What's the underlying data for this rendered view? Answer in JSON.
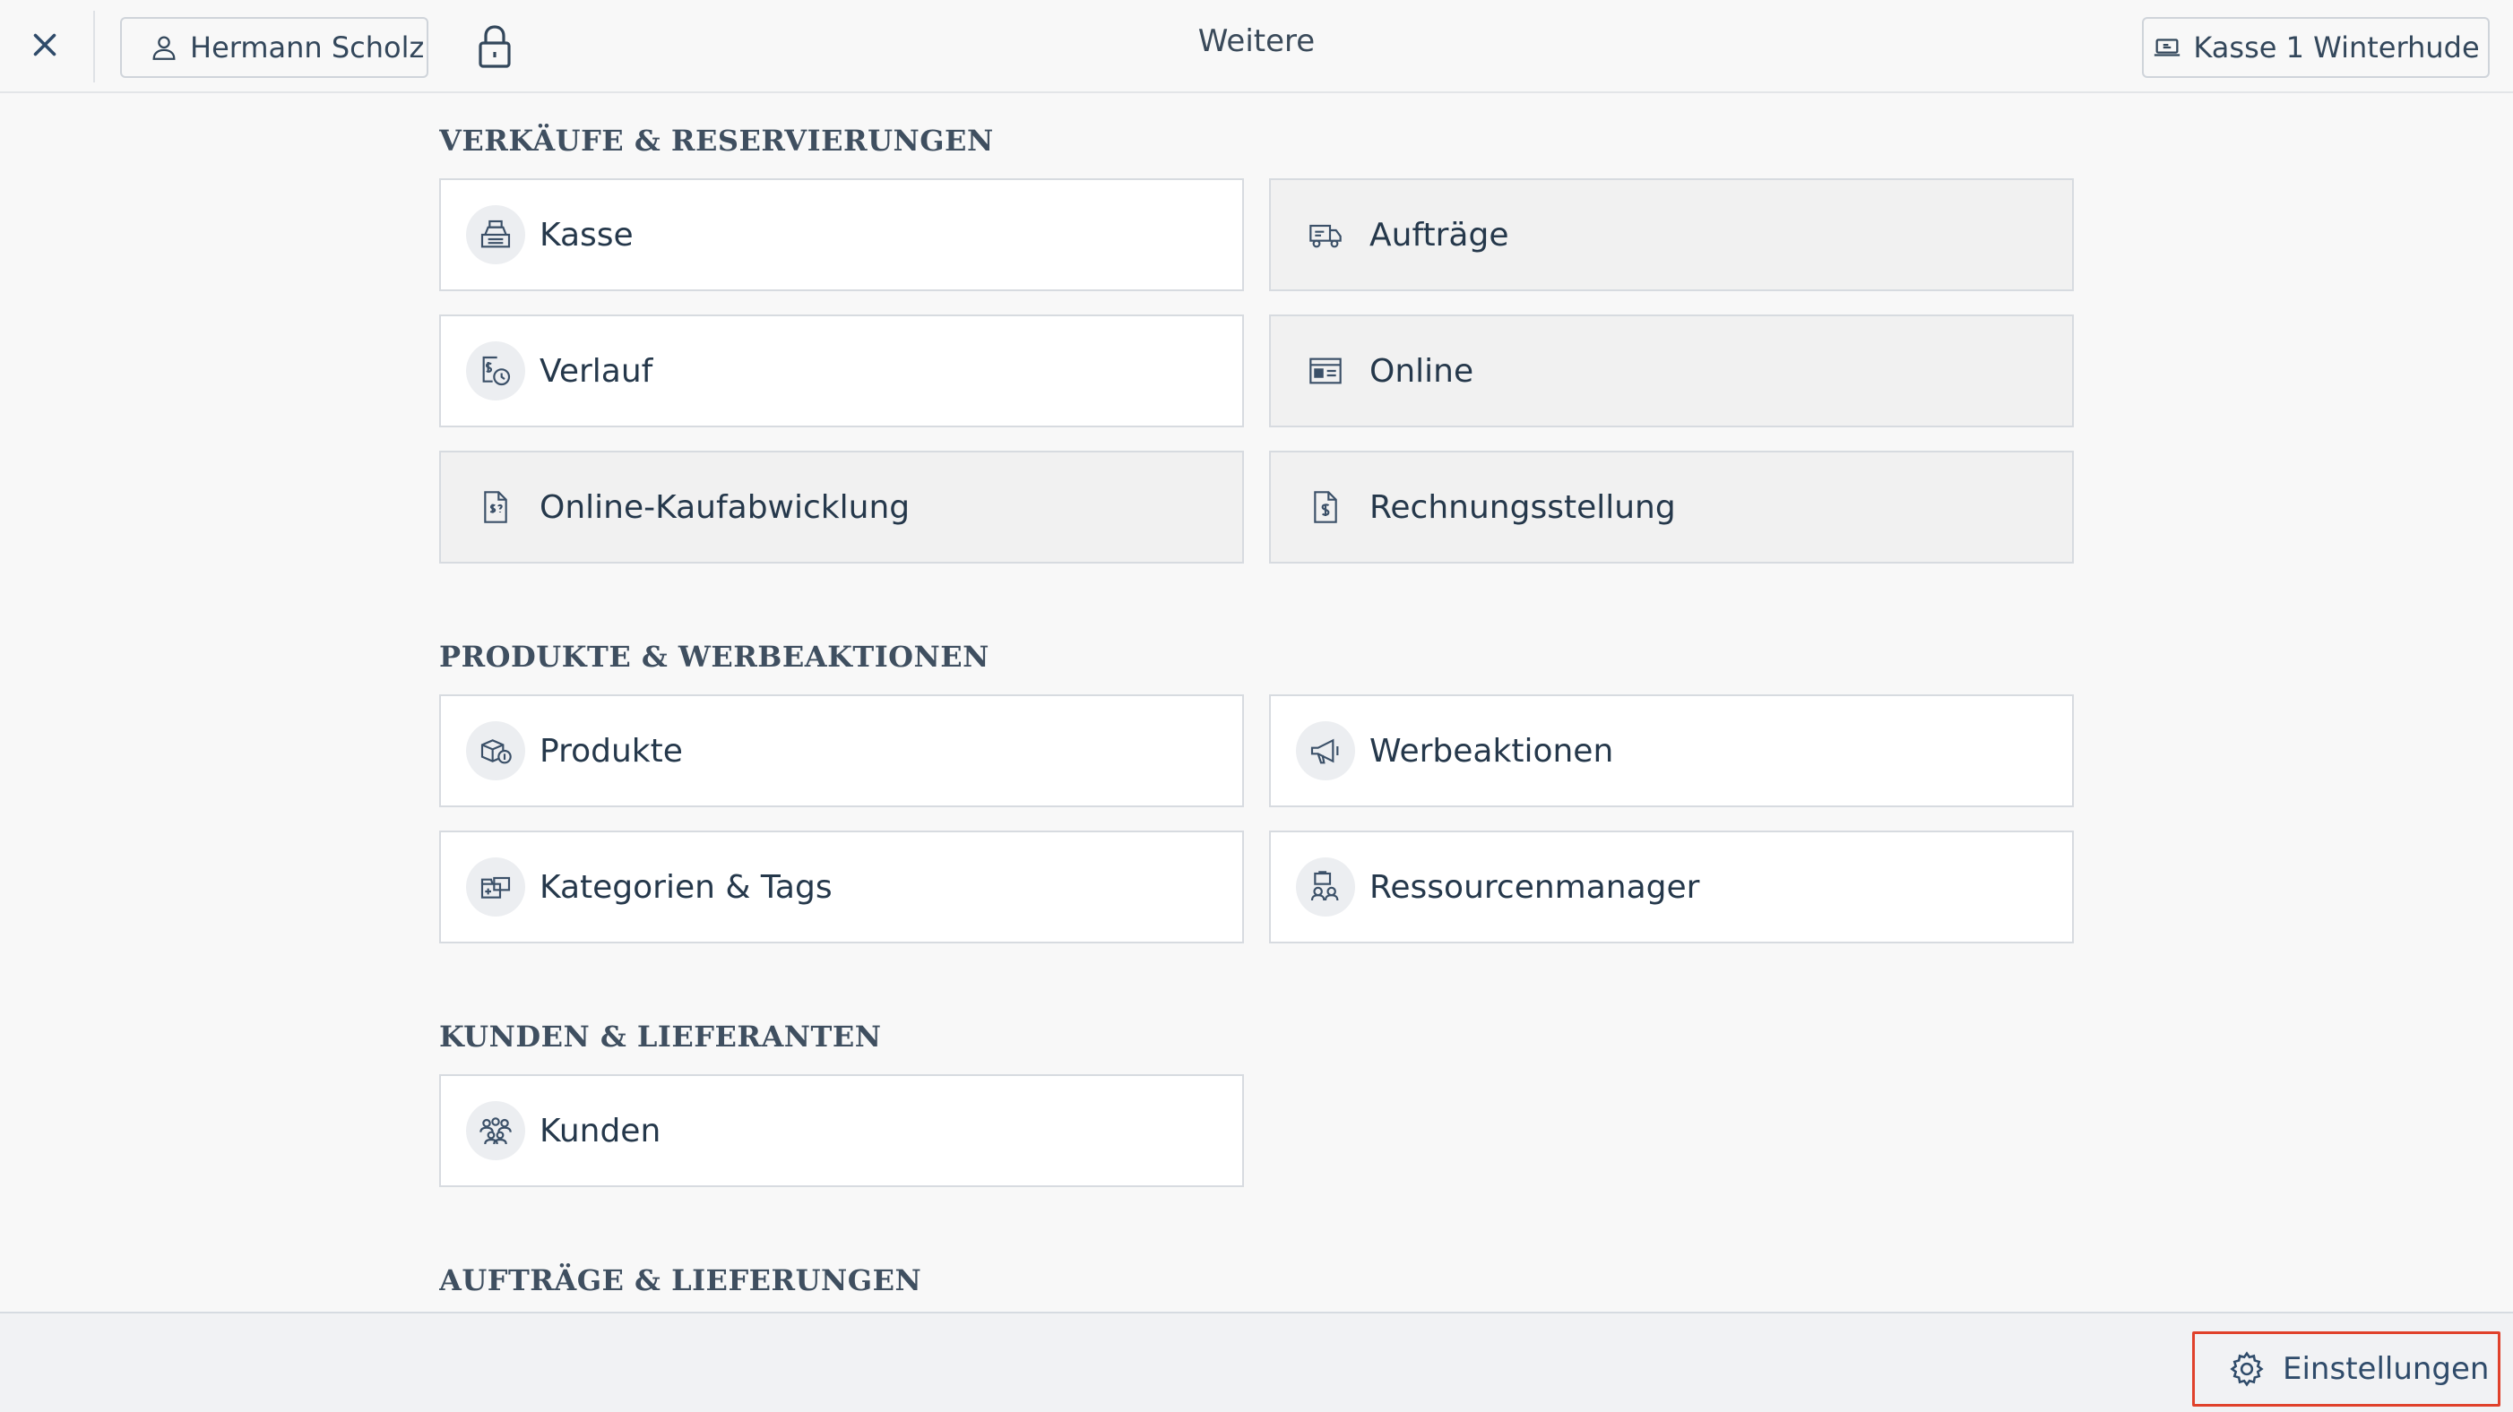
{
  "header": {
    "title": "Weitere",
    "user_name": "Hermann Scholz",
    "register_name": "Kasse 1 Winterhude"
  },
  "sections": [
    {
      "title": "VERKÄUFE & RESERVIERUNGEN",
      "tiles": [
        {
          "label": "Kasse",
          "icon": "cash-register-icon"
        },
        {
          "label": "Aufträge",
          "icon": "delivery-truck-icon"
        },
        {
          "label": "Verlauf",
          "icon": "history-icon"
        },
        {
          "label": "Online",
          "icon": "online-store-icon"
        },
        {
          "label": "Online-Kaufabwicklung",
          "icon": "online-checkout-icon"
        },
        {
          "label": "Rechnungsstellung",
          "icon": "invoice-icon"
        }
      ]
    },
    {
      "title": "PRODUKTE & WERBEAKTIONEN",
      "tiles": [
        {
          "label": "Produkte",
          "icon": "products-icon"
        },
        {
          "label": "Werbeaktionen",
          "icon": "megaphone-icon"
        },
        {
          "label": "Kategorien & Tags",
          "icon": "categories-icon"
        },
        {
          "label": "Ressourcenmanager",
          "icon": "resources-icon"
        }
      ]
    },
    {
      "title": "KUNDEN & LIEFERANTEN",
      "tiles": [
        {
          "label": "Kunden",
          "icon": "customers-icon"
        }
      ]
    },
    {
      "title": "AUFTRÄGE & LIEFERUNGEN",
      "tiles": []
    }
  ],
  "footer": {
    "settings_label": "Einstellungen"
  },
  "colors": {
    "accent": "#2f4b6a",
    "highlight_border": "#e0412b",
    "tile_border": "#d7dbe0",
    "disabled_tile_bg": "#f1f1f1"
  }
}
